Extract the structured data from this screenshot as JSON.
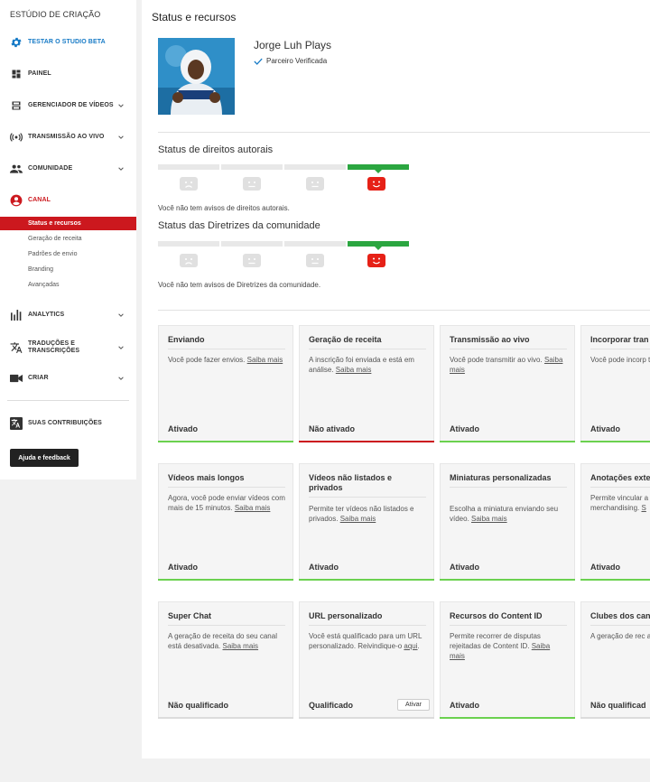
{
  "sidebar": {
    "studio_title": "ESTÚDIO DE CRIAÇÃO",
    "test_beta": "TESTAR O STUDIO BETA",
    "items": {
      "painel": "PAINEL",
      "video_manager": "GERENCIADOR DE VÍDEOS",
      "live": "TRANSMISSÃO AO VIVO",
      "community": "COMUNIDADE",
      "channel": "CANAL",
      "analytics": "ANALYTICS",
      "translations_line1": "TRADUÇÕES E",
      "translations_line2": "TRANSCRIÇÕES",
      "create": "CRIAR",
      "contributions": "SUAS CONTRIBUIÇÕES"
    },
    "channel_sub": [
      "Status e recursos",
      "Geração de receita",
      "Padrões de envio",
      "Branding",
      "Avançadas"
    ],
    "help_button": "Ajuda e feedback",
    "colors": {
      "accent_blue": "#167ac6",
      "accent_red": "#cc181e"
    }
  },
  "main": {
    "page_title": "Status e recursos",
    "channel_name": "Jorge Luh Plays",
    "verified_label": "Parceiro Verificada",
    "copyright": {
      "title": "Status de direitos autorais",
      "message": "Você não tem avisos de direitos autorais."
    },
    "community": {
      "title": "Status das Diretrizes da comunidade",
      "message": "Você não tem avisos de Diretrizes da comunidade."
    },
    "cards": [
      {
        "title": "Enviando",
        "desc": "Você pode fazer envios. ",
        "link": "Saiba mais",
        "status": "Ativado",
        "bar": "#6bd14f"
      },
      {
        "title": "Geração de receita",
        "desc": "A inscrição foi enviada e está em análise. ",
        "link": "Saiba mais",
        "status": "Não ativado",
        "bar": "#cc181e"
      },
      {
        "title": "Transmissão ao vivo",
        "desc": "Você pode transmitir ao vivo. ",
        "link": "Saiba mais",
        "status": "Ativado",
        "bar": "#6bd14f"
      },
      {
        "title": "Incorporar tran vivo",
        "desc": "Você pode incorp transmissões ao",
        "link": "",
        "status": "Ativado",
        "bar": "#6bd14f"
      },
      {
        "title": "Vídeos mais longos",
        "desc": "Agora, você pode enviar vídeos com mais de 15 minutos. ",
        "link": "Saiba mais",
        "status": "Ativado",
        "bar": "#6bd14f"
      },
      {
        "title": "Vídeos não listados e privados",
        "desc": "Permite ter vídeos não listados e privados. ",
        "link": "Saiba mais",
        "status": "Ativado",
        "bar": "#6bd14f"
      },
      {
        "title": "Miniaturas personalizadas",
        "desc": "Escolha a miniatura enviando seu vídeo. ",
        "link": "Saiba mais",
        "status": "Ativado",
        "bar": "#6bd14f"
      },
      {
        "title": "Anotações exte",
        "desc": "Permite vincular a sites externos ou merchandising. ",
        "link": "S",
        "status": "Ativado",
        "bar": "#6bd14f"
      },
      {
        "title": "Super Chat",
        "desc": "A geração de receita do seu canal está desativada. ",
        "link": "Saiba mais",
        "status": "Não qualificado",
        "bar": ""
      },
      {
        "title": "URL personalizado",
        "desc": "Você está qualificado para um URL personalizado. Reivindique-o ",
        "link": "aqui",
        "suffix": ".",
        "status": "Qualificado",
        "bar": "",
        "button": "Ativar"
      },
      {
        "title": "Recursos do Content ID",
        "desc": "Permite recorrer de disputas rejeitadas de Content ID. ",
        "link": "Saiba mais",
        "status": "Ativado",
        "bar": "#6bd14f"
      },
      {
        "title": "Clubes dos can",
        "desc": "A geração de rec ativada no seu ca",
        "link": "",
        "status": "Não qualificad",
        "bar": ""
      }
    ]
  }
}
